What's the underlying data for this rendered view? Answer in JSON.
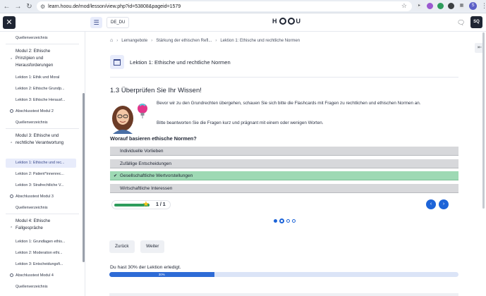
{
  "browser": {
    "url": "learn.hoou.de/mod/lesson/view.php?id=53808&pageid=1579",
    "profile_initial": "S"
  },
  "header": {
    "lang_label": "DE_DU",
    "logo_letters": [
      "H",
      "U"
    ],
    "avatar_initials": "SQ"
  },
  "sidebar": {
    "items": [
      {
        "label": "Quellenverzeichnis",
        "type": "link"
      },
      {
        "label": "Modul 2: Ethische Prinzipien und Herausforderungen",
        "type": "module"
      },
      {
        "label": "Lektion 1: Ethik und Moral",
        "type": "link"
      },
      {
        "label": "Lektion 2: Ethische Grundp...",
        "type": "link"
      },
      {
        "label": "Lektion 3: Ethische Herausf...",
        "type": "link"
      },
      {
        "label": "Abschlusstest Modul 2",
        "type": "quiz"
      },
      {
        "label": "Quellenverzeichnis",
        "type": "link"
      },
      {
        "label": "Modul 3: Ethische und rechtliche Verantwortung",
        "type": "module"
      },
      {
        "label": "Lektion 1: Ethische und rec...",
        "type": "active"
      },
      {
        "label": "Lektion 2: Patient*innenrec...",
        "type": "link"
      },
      {
        "label": "Lektion 3: Strafrechtliche V...",
        "type": "link"
      },
      {
        "label": "Abschlusstest Modul 3",
        "type": "quiz"
      },
      {
        "label": "Quellenverzeichnis",
        "type": "link"
      },
      {
        "label": "Modul 4: Ethische Fallgespräche",
        "type": "module"
      },
      {
        "label": "Lektion 1: Grundlagen ethis...",
        "type": "link"
      },
      {
        "label": "Lektion 2: Moderation ethi...",
        "type": "link"
      },
      {
        "label": "Lektion 3: Entscheidungsfi...",
        "type": "link"
      },
      {
        "label": "Abschlusstest Modul 4",
        "type": "quiz"
      },
      {
        "label": "Quellenverzeichnis",
        "type": "link"
      }
    ]
  },
  "breadcrumb": [
    "Lernangebote",
    "Stärkung der ethischen Refl...",
    "Lektion 1: Ethische und rechtliche Normen"
  ],
  "lesson": {
    "title": "Lektion 1: Ethische und rechtliche Normen",
    "section_title": "1.3 Überprüfen Sie Ihr Wissen!",
    "intro": "Bevor wir zu den Grundrechten übergehen, schauen Sie sich bitte die Flashcards mit Fragen zu rechtlichen und ethischen Normen an.",
    "instruction": "Bitte beantworten Sie die Fragen kurz und prägnant mit einem oder wenigen Worten."
  },
  "quiz": {
    "question": "Worauf basieren ethische Normen?",
    "answers": [
      {
        "label": "Individuelle Vorlieben",
        "correct": false
      },
      {
        "label": "Zufällige Entscheidungen",
        "correct": false
      },
      {
        "label": "Gesellschaftliche Wertvorstellungen",
        "correct": true
      },
      {
        "label": "Wirtschaftliche Interessen",
        "correct": false
      }
    ],
    "score_label": "1 / 1",
    "score_fraction": 1.0,
    "dots_total": 4,
    "dots_current": 2
  },
  "buttons": {
    "back": "Zurück",
    "next": "Weiter"
  },
  "progress": {
    "text": "Du hast 30% der Lektion erledigt.",
    "percent": 30,
    "percent_label": "30%"
  },
  "colors": {
    "accent": "#1d64d8",
    "correct": "#9ed9b4",
    "progress": "#2e6bd6"
  }
}
